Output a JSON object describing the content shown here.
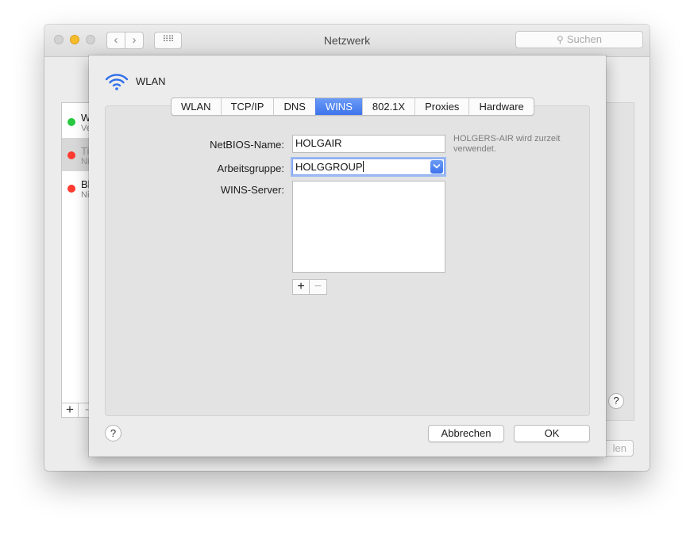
{
  "window": {
    "title": "Netzwerk",
    "search_placeholder": "Suchen",
    "back_glyph": "‹",
    "forward_glyph": "›",
    "grid_glyph": "⠿⠿",
    "services": [
      {
        "name": "W",
        "status": "Ve",
        "status_color": "#28c840"
      },
      {
        "name": "Ti",
        "status": "Ni",
        "status_color": "#ff3b30"
      },
      {
        "name": "Bl",
        "status": "Ni",
        "status_color": "#ff3b30"
      }
    ],
    "add_glyph": "+",
    "remove_glyph": "-",
    "help_glyph": "?",
    "partial_button_label": "len"
  },
  "sheet": {
    "title": "WLAN",
    "tabs": [
      {
        "label": "WLAN"
      },
      {
        "label": "TCP/IP"
      },
      {
        "label": "DNS"
      },
      {
        "label": "WINS",
        "active": true
      },
      {
        "label": "802.1X"
      },
      {
        "label": "Proxies"
      },
      {
        "label": "Hardware"
      }
    ],
    "netbios_label": "NetBIOS-Name:",
    "netbios_value": "HOLGAIR",
    "netbios_hint": "HOLGERS-AIR wird zurzeit verwendet.",
    "workgroup_label": "Arbeitsgruppe:",
    "workgroup_value": "HOLGGROUP",
    "wins_label": "WINS-Server:",
    "add_glyph": "+",
    "remove_glyph": "−",
    "help_glyph": "?",
    "cancel_label": "Abbrechen",
    "ok_label": "OK"
  },
  "colors": {
    "accent": "#3d73ed",
    "status_green": "#28c840",
    "status_red": "#ff3b30"
  }
}
